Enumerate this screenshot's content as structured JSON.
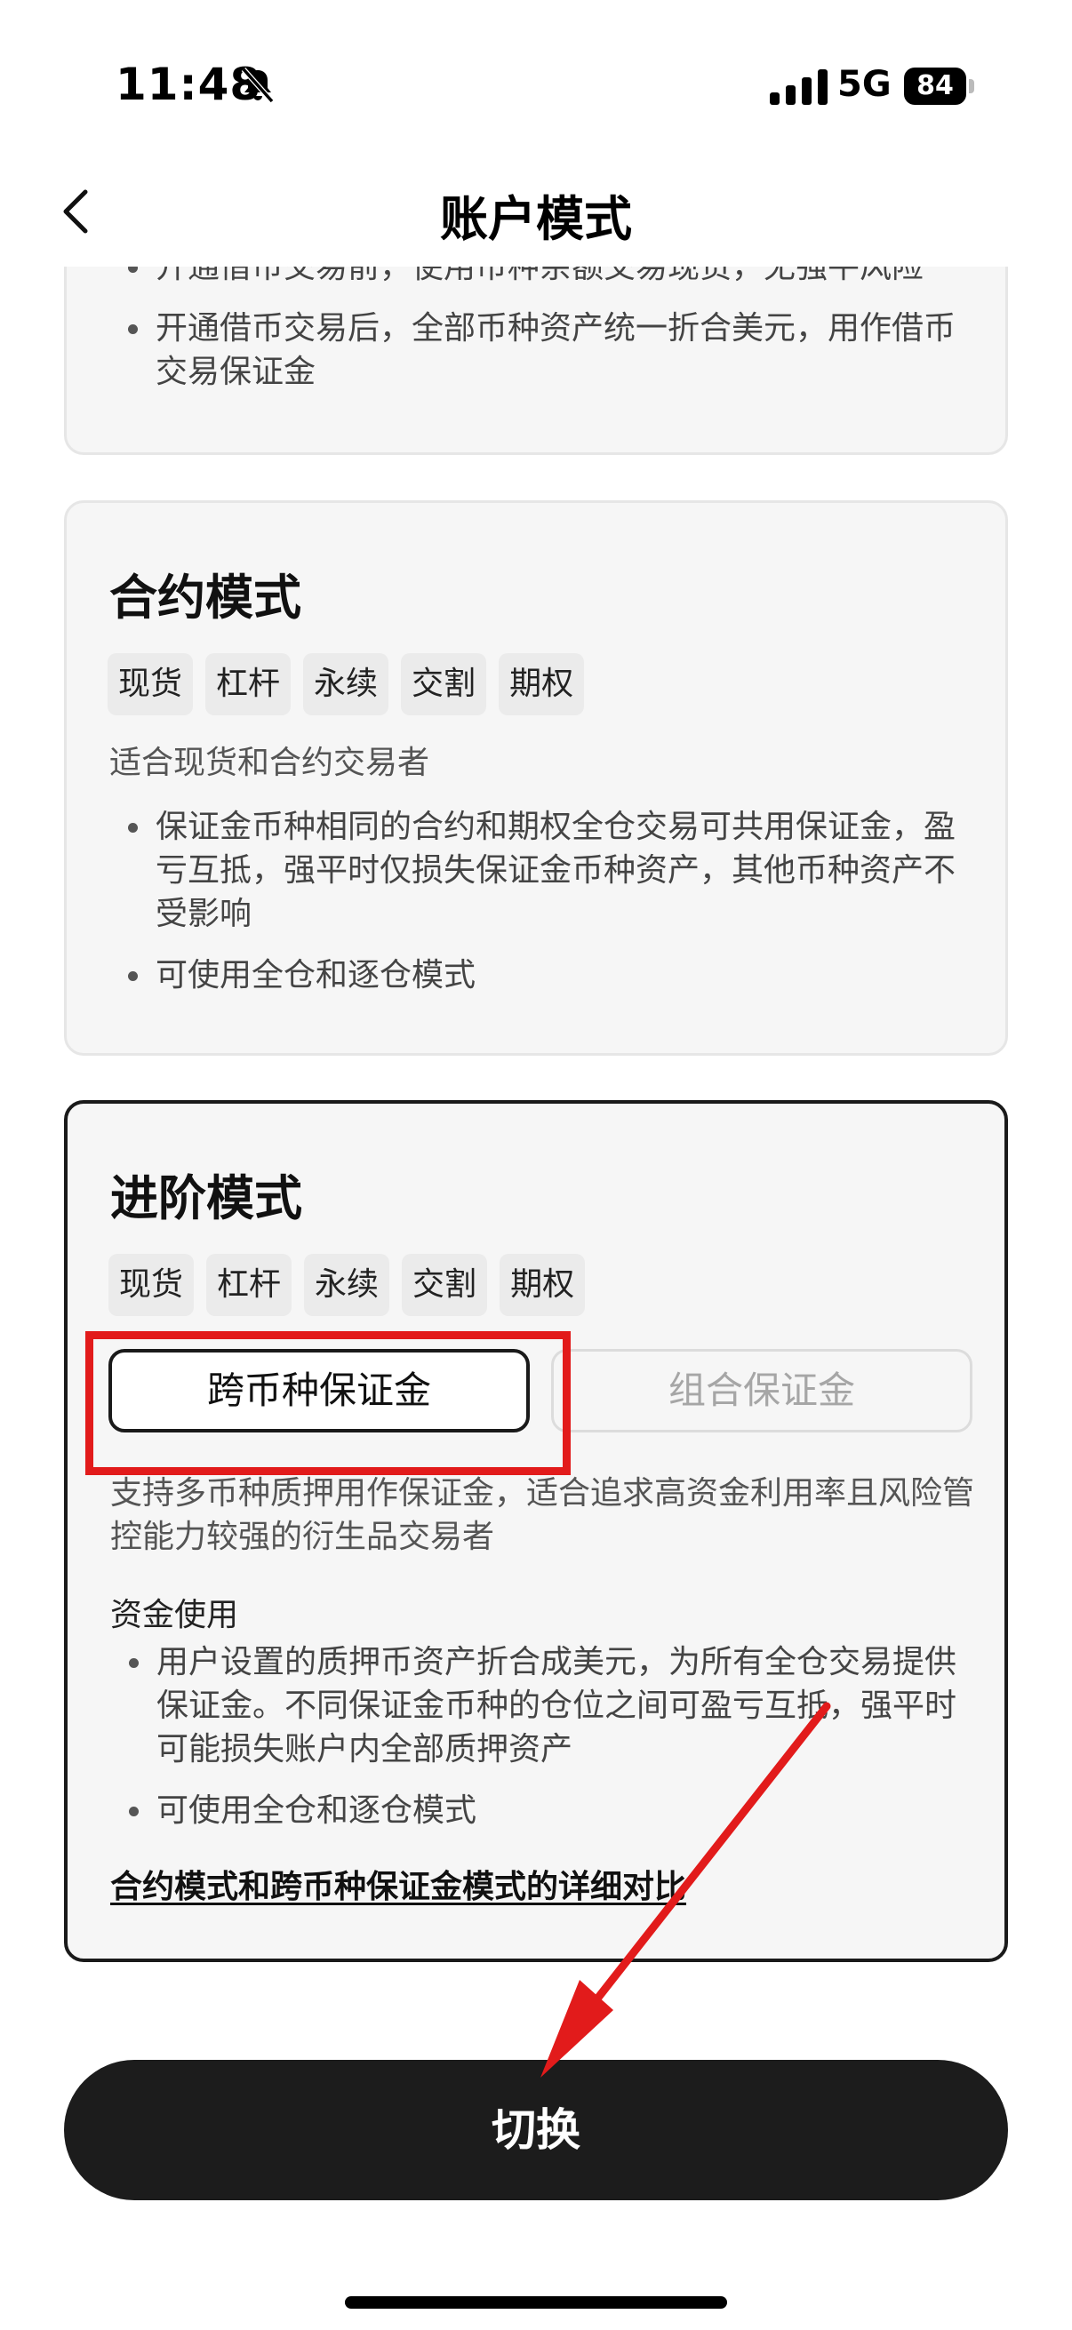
{
  "status_bar": {
    "time": "11:48",
    "network": "5G",
    "battery": "84"
  },
  "nav": {
    "title": "账户模式"
  },
  "top_card": {
    "bullets": [
      "开通借币交易前，使用币种余额交易现货，无强平风险",
      "开通借币交易后，全部币种资产统一折合美元，用作借币交易保证金"
    ]
  },
  "contract_card": {
    "title": "合约模式",
    "tags": [
      "现货",
      "杠杆",
      "永续",
      "交割",
      "期权"
    ],
    "description": "适合现货和合约交易者",
    "bullets": [
      "保证金币种相同的合约和期权全仓交易可共用保证金，盈亏互抵，强平时仅损失保证金币种资产，其他币种资产不受影响",
      "可使用全仓和逐仓模式"
    ]
  },
  "advanced_card": {
    "title": "进阶模式",
    "tags": [
      "现货",
      "杠杆",
      "永续",
      "交割",
      "期权"
    ],
    "segments": {
      "active": "跨币种保证金",
      "inactive": "组合保证金"
    },
    "description": "支持多币种质押用作保证金，适合追求高资金利用率且风险管控能力较强的衍生品交易者",
    "fund_usage_heading": "资金使用",
    "bullets": [
      "用户设置的质押币资产折合成美元，为所有全仓交易提供保证金。不同保证金币种的仓位之间可盈亏互抵，强平时可能损失账户内全部质押资产",
      "可使用全仓和逐仓模式"
    ],
    "detail_link": "合约模式和跨币种保证金模式的详细对比"
  },
  "switch_button": "切换",
  "colors": {
    "annotation_red": "#e21b1b",
    "button_dark": "#1c1c1c"
  }
}
